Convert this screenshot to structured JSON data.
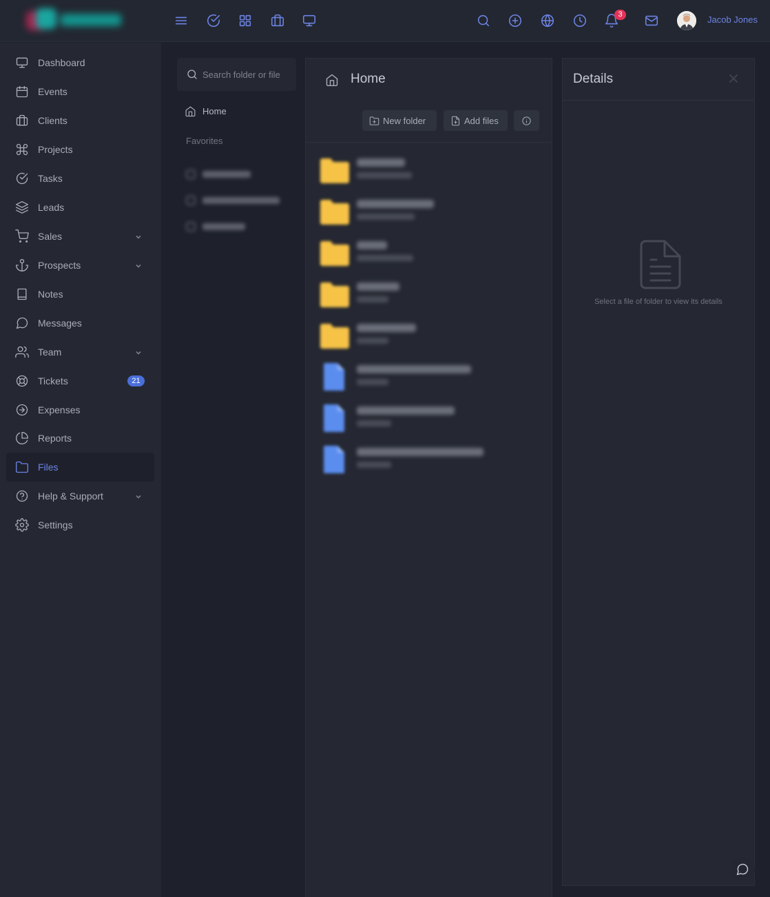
{
  "topbar": {
    "icons": [
      "menu-icon",
      "check-circle-icon",
      "grid-icon",
      "briefcase-icon",
      "monitor-icon",
      "search-icon",
      "plus-circle-icon",
      "globe-icon",
      "clock-icon",
      "bell-icon",
      "mail-icon"
    ],
    "notification_count": "3",
    "user_name": "Jacob Jones",
    "accent_color": "#6d84e6"
  },
  "sidebar": {
    "items": [
      {
        "label": "Dashboard",
        "icon": "monitor-icon"
      },
      {
        "label": "Events",
        "icon": "calendar-icon"
      },
      {
        "label": "Clients",
        "icon": "briefcase-icon"
      },
      {
        "label": "Projects",
        "icon": "command-icon"
      },
      {
        "label": "Tasks",
        "icon": "check-circle-icon"
      },
      {
        "label": "Leads",
        "icon": "layers-icon"
      },
      {
        "label": "Sales",
        "icon": "cart-icon"
      },
      {
        "label": "Prospects",
        "icon": "anchor-icon"
      },
      {
        "label": "Notes",
        "icon": "book-icon"
      },
      {
        "label": "Messages",
        "icon": "message-icon"
      },
      {
        "label": "Team",
        "icon": "users-icon"
      },
      {
        "label": "Tickets",
        "icon": "life-buoy-icon",
        "badge": "21"
      },
      {
        "label": "Expenses",
        "icon": "arrow-right-circle-icon"
      },
      {
        "label": "Reports",
        "icon": "pie-chart-icon"
      },
      {
        "label": "Files",
        "icon": "folder-icon",
        "active": true
      },
      {
        "label": "Help & Support",
        "icon": "help-circle-icon"
      },
      {
        "label": "Settings",
        "icon": "settings-icon"
      }
    ]
  },
  "folder_nav": {
    "search_placeholder": "Search folder or file",
    "home_label": "Home",
    "favorites_label": "Favorites"
  },
  "main": {
    "title": "Home",
    "new_folder_label": "New folder",
    "add_files_label": "Add files",
    "folder_color": "#f6c347",
    "file_color": "#5b8def"
  },
  "details": {
    "title": "Details",
    "hint": "Select a file of folder to view its details"
  }
}
